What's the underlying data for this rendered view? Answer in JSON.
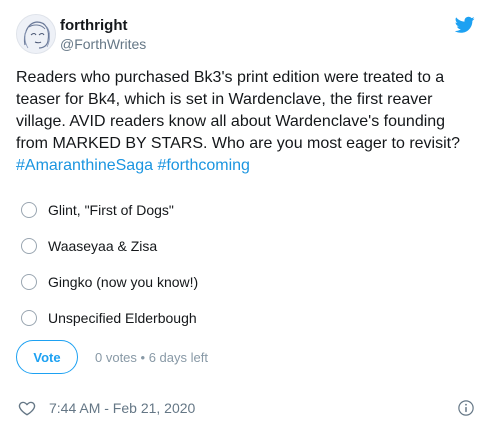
{
  "author": {
    "display_name": "forthright",
    "handle": "@ForthWrites",
    "avatar_icon": "sketch-portrait-avatar",
    "platform_icon": "twitter-bird-icon"
  },
  "tweet": {
    "text": "Readers who purchased Bk3's print edition were treated to a\nteaser for Bk4, which is set in Wardenclave, the first reaver\nvillage. AVID readers know all about Wardenclave's founding\nfrom MARKED BY STARS. Who are you most eager to revisit?\n",
    "hashtag_1": "#AmaranthineSaga",
    "hashtag_2": "#forthcoming"
  },
  "poll": {
    "options": [
      {
        "label": "Glint, \"First of Dogs\""
      },
      {
        "label": "Waaseyaa & Zisa"
      },
      {
        "label": "Gingko (now you know!)"
      },
      {
        "label": "Unspecified Elderbough"
      }
    ],
    "vote_label": "Vote",
    "meta": "0 votes • 6 days left"
  },
  "footer": {
    "timestamp": "7:44 AM - Feb 21, 2020",
    "like_icon": "heart-icon",
    "info_icon": "info-icon"
  },
  "colors": {
    "accent": "#1da1f2",
    "hashtag": "#1b95e0",
    "text": "#14171a",
    "secondary": "#657786"
  }
}
